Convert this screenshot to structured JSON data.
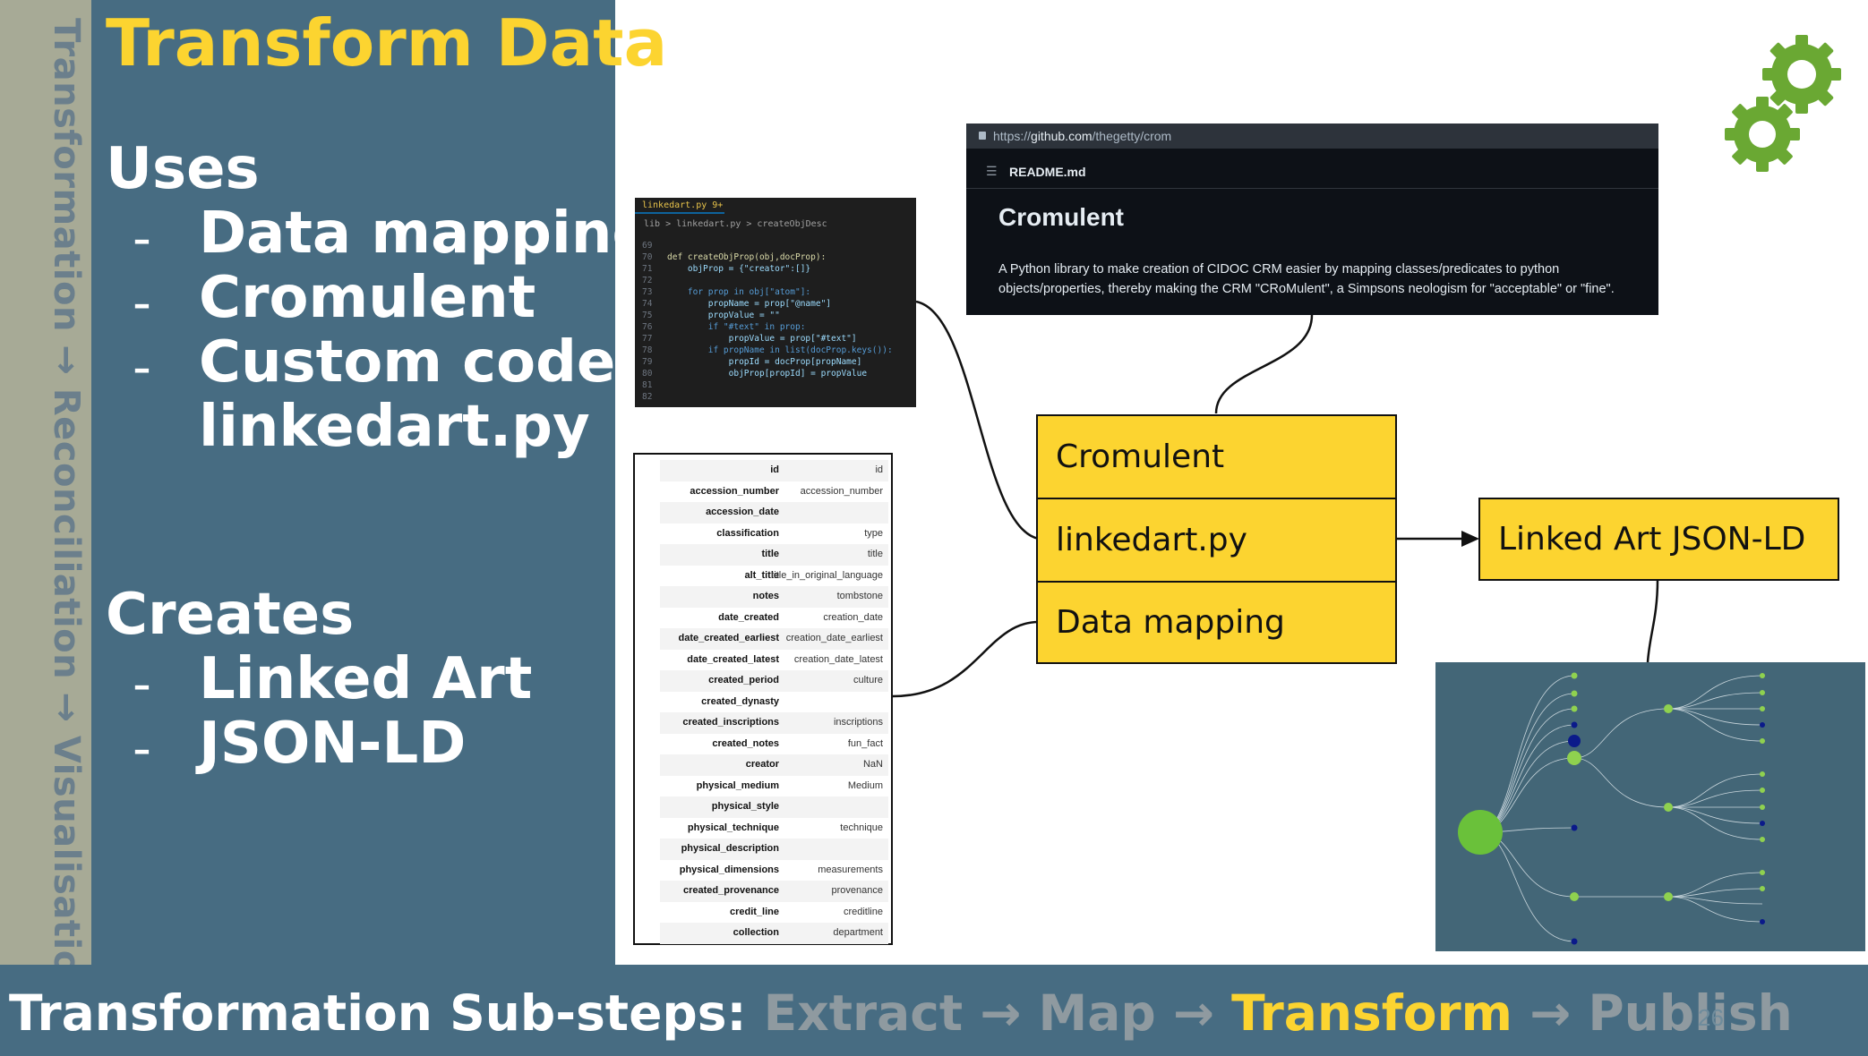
{
  "sidebar": {
    "text": "Transformation → Reconciliation → Visualisation"
  },
  "title": "Transform Data",
  "uses": {
    "heading": "Uses",
    "items": [
      "Data mapping",
      "Cromulent",
      "Custom code",
      "linkedart.py"
    ]
  },
  "creates": {
    "heading": "Creates",
    "items": [
      "Linked Art",
      "JSON-LD"
    ]
  },
  "bullet_dash": "-",
  "footer": {
    "label": "Transformation Sub-steps:",
    "steps": [
      "Extract",
      "Map",
      "Transform",
      "Publish"
    ],
    "arrow": "→",
    "active_step": "Transform",
    "page_number": "26"
  },
  "code_screenshot": {
    "tab": "linkedart.py 9+",
    "breadcrumb": "lib > linkedart.py > createObjDesc",
    "lines": [
      {
        "n": "69",
        "code": ""
      },
      {
        "n": "70",
        "code": "def createObjProp(obj,docProp):"
      },
      {
        "n": "71",
        "code": "    objProp = {\"creator\":[]}"
      },
      {
        "n": "72",
        "code": ""
      },
      {
        "n": "73",
        "code": "    for prop in obj[\"atom\"]:"
      },
      {
        "n": "74",
        "code": "        propName = prop[\"@name\"]"
      },
      {
        "n": "75",
        "code": "        propValue = \"\""
      },
      {
        "n": "76",
        "code": "        if \"#text\" in prop:"
      },
      {
        "n": "77",
        "code": "            propValue = prop[\"#text\"]"
      },
      {
        "n": "78",
        "code": "        if propName in list(docProp.keys()):"
      },
      {
        "n": "79",
        "code": "            propId = docProp[propName]"
      },
      {
        "n": "80",
        "code": "            objProp[propId] = propValue"
      },
      {
        "n": "81",
        "code": ""
      },
      {
        "n": "82",
        "code": ""
      }
    ]
  },
  "github_screenshot": {
    "url_prefix": "https://",
    "url_domain": "github.com",
    "url_path": "/thegetty/crom",
    "list_icon": "☰",
    "readme": "README.md",
    "heading": "Cromulent",
    "description": "A Python library to make creation of CIDOC CRM easier by mapping classes/predicates to python objects/properties, thereby making the CRM \"CRoMulent\", a Simpsons neologism for \"acceptable\" or \"fine\"."
  },
  "mapping_table": [
    {
      "key": "id",
      "value": "id"
    },
    {
      "key": "accession_number",
      "value": "accession_number"
    },
    {
      "key": "accession_date",
      "value": ""
    },
    {
      "key": "classification",
      "value": "type"
    },
    {
      "key": "title",
      "value": "title"
    },
    {
      "key": "alt_title",
      "value": "title_in_original_language"
    },
    {
      "key": "notes",
      "value": "tombstone"
    },
    {
      "key": "date_created",
      "value": "creation_date"
    },
    {
      "key": "date_created_earliest",
      "value": "creation_date_earliest"
    },
    {
      "key": "date_created_latest",
      "value": "creation_date_latest"
    },
    {
      "key": "created_period",
      "value": "culture"
    },
    {
      "key": "created_dynasty",
      "value": ""
    },
    {
      "key": "created_inscriptions",
      "value": "inscriptions"
    },
    {
      "key": "created_notes",
      "value": "fun_fact"
    },
    {
      "key": "creator",
      "value": "NaN"
    },
    {
      "key": "physical_medium",
      "value": "Medium"
    },
    {
      "key": "physical_style",
      "value": ""
    },
    {
      "key": "physical_technique",
      "value": "technique"
    },
    {
      "key": "physical_description",
      "value": ""
    },
    {
      "key": "physical_dimensions",
      "value": "measurements"
    },
    {
      "key": "created_provenance",
      "value": "provenance"
    },
    {
      "key": "credit_line",
      "value": "creditline"
    },
    {
      "key": "collection",
      "value": "department"
    }
  ],
  "diagram": {
    "stack": [
      "Cromulent",
      "linkedart.py",
      "Data mapping"
    ],
    "output": "Linked Art JSON-LD"
  },
  "colors": {
    "accent": "#fcd430",
    "panel": "#476c82",
    "sidebar": "#a7aa96",
    "gear": "#6aa833"
  }
}
